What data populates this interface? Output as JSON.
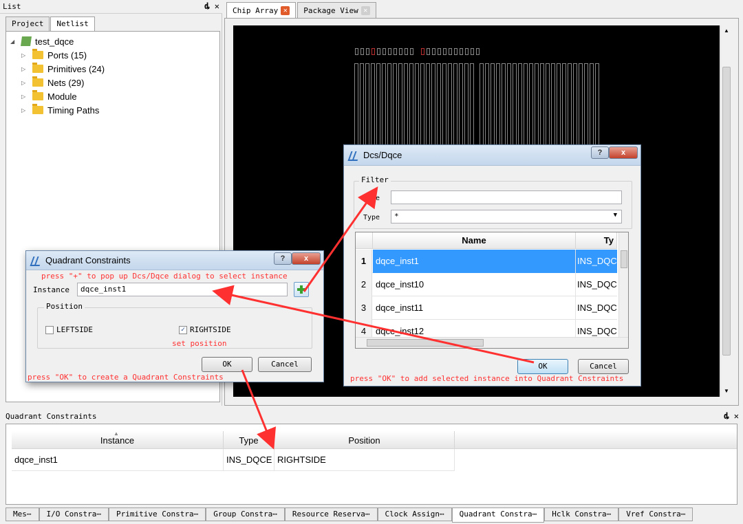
{
  "left_panel": {
    "title": "List",
    "controls": "ȡ ✕",
    "tabs": [
      "Project",
      "Netlist"
    ],
    "tree": [
      {
        "label": "test_dqce",
        "level": 0
      },
      {
        "label": "Ports (15)",
        "level": 1
      },
      {
        "label": "Primitives (24)",
        "level": 1
      },
      {
        "label": "Nets (29)",
        "level": 1
      },
      {
        "label": "Module",
        "level": 1
      },
      {
        "label": "Timing Paths",
        "level": 1
      }
    ]
  },
  "chip_tabs": [
    {
      "label": "Chip Array",
      "active": true
    },
    {
      "label": "Package View",
      "active": false
    }
  ],
  "quadrant_dialog": {
    "title": "Quadrant Constraints",
    "help": "?",
    "close": "x",
    "hint_top": "press \"+\" to pop up Dcs/Dqce dialog to select instance",
    "instance_label": "Instance",
    "instance_value": "dqce_inst1",
    "position_group": "Position",
    "leftside": "LEFTSIDE",
    "rightside": "RIGHTSIDE",
    "set_position": "set position",
    "ok": "OK",
    "cancel": "Cancel",
    "hint_bottom": "press \"OK\" to create a Quadrant Constraints"
  },
  "dcs_dialog": {
    "title": "Dcs/Dqce",
    "help": "?",
    "close": "x",
    "filter_group": "Filter",
    "name_label": "Name",
    "type_label": "Type",
    "type_value": "*",
    "headers": [
      "Name",
      "Ty"
    ],
    "rows": [
      {
        "num": "1",
        "name": "dqce_inst1",
        "type": "INS_DQCE"
      },
      {
        "num": "2",
        "name": "dqce_inst10",
        "type": "INS_DQCE"
      },
      {
        "num": "3",
        "name": "dqce_inst11",
        "type": "INS_DQCE"
      },
      {
        "num": "4",
        "name": "dqce_inst12",
        "type": "INS_DQCE"
      }
    ],
    "ok": "OK",
    "cancel": "Cancel",
    "hint_bottom": "press \"OK\" to add selected instance into Quadrant Cnstraints"
  },
  "bottom_panel": {
    "title": "Quadrant Constraints",
    "controls": "ȡ ✕",
    "headers": [
      "Instance",
      "Type",
      "Position"
    ],
    "row": {
      "instance": "dqce_inst1",
      "type": "INS_DQCE",
      "position": "RIGHTSIDE"
    }
  },
  "bottom_tabs": [
    "Mes⋯",
    "I/O Constra⋯",
    "Primitive Constra⋯",
    "Group Constra⋯",
    "Resource Reserva⋯",
    "Clock Assign⋯",
    "Quadrant Constra⋯",
    "Hclk Constra⋯",
    "Vref Constra⋯"
  ],
  "colors": {
    "annotation": "#ff3030",
    "selection": "#3399ff"
  }
}
